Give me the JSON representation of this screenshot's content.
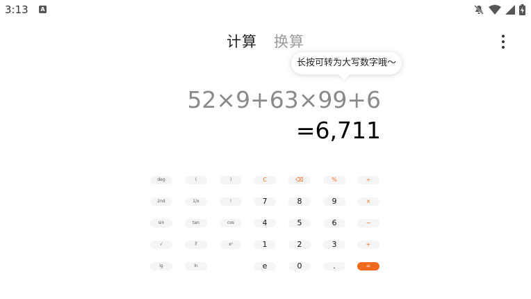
{
  "status": {
    "time": "3:13",
    "app_badge": "A"
  },
  "tabs": {
    "calc": "计算",
    "convert": "换算"
  },
  "tooltip": "长按可转为大写数字哦～",
  "display": {
    "expression": "52×9+63×99+6",
    "result": "=6,711"
  },
  "keys": [
    [
      "deg",
      "(",
      ")",
      "C",
      "⌫",
      "%",
      "÷"
    ],
    [
      "2nd",
      "1/x",
      "!",
      "7",
      "8",
      "9",
      "×"
    ],
    [
      "sin",
      "tan",
      "cos",
      "4",
      "5",
      "6",
      "−"
    ],
    [
      "√",
      "∛",
      "xʸ",
      "1",
      "2",
      "3",
      "+"
    ],
    [
      "lg",
      "ln",
      "",
      "e",
      "0",
      ".",
      "="
    ]
  ]
}
